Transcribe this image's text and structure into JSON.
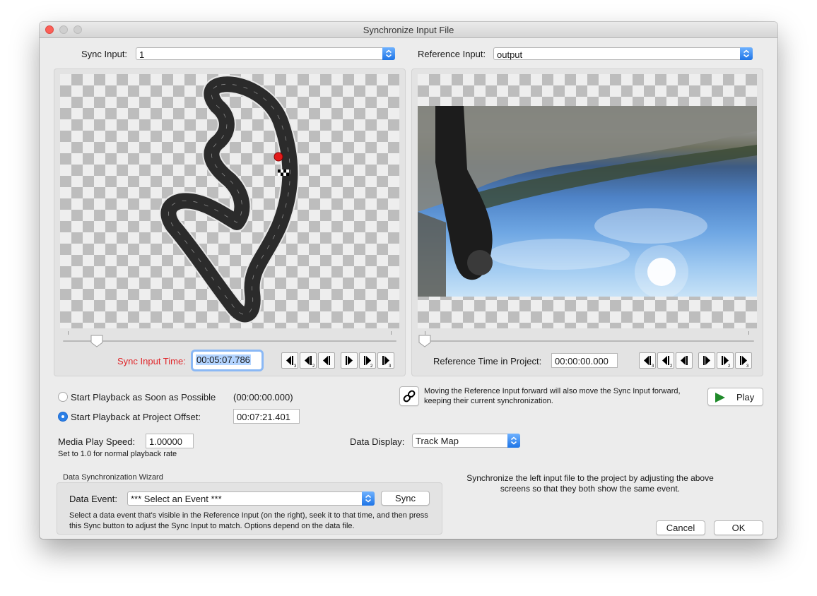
{
  "window": {
    "title": "Synchronize Input File"
  },
  "sync_input": {
    "label": "Sync Input:",
    "value": "1",
    "time_label": "Sync Input Time:",
    "time_value": "00:05:07.786",
    "slider_value": 0.09
  },
  "reference_input": {
    "label": "Reference Input:",
    "value": "output",
    "time_label": "Reference Time in Project:",
    "time_value": "00:00:00.000",
    "slider_value": 0.0
  },
  "playback": {
    "asap_label": "Start Playback as Soon as Possible",
    "asap_value": "(00:00:00.000)",
    "offset_label": "Start Playback at Project Offset:",
    "offset_value": "00:07:21.401",
    "selected": "offset"
  },
  "link": {
    "note": "Moving the Reference Input forward will also move the Sync Input forward, keeping their current synchronization."
  },
  "play_button": {
    "label": "Play"
  },
  "speed": {
    "label": "Media Play Speed:",
    "value": "1.00000",
    "hint": "Set to 1.0 for normal playback rate"
  },
  "data_display": {
    "label": "Data Display:",
    "value": "Track Map"
  },
  "wizard": {
    "title": "Data Synchronization Wizard",
    "event_label": "Data Event:",
    "event_value": "*** Select an Event ***",
    "sync_button": "Sync",
    "help": "Select a data event that's visible in the Reference Input (on the right), seek it to that time, and then press this Sync button to adjust the Sync Input to match. Options depend on the data file."
  },
  "instructions": "Synchronize the left input file to the project by adjusting the above screens so that they both show the same event.",
  "buttons": {
    "cancel": "Cancel",
    "ok": "OK"
  },
  "colors": {
    "accent": "#2b7fe6",
    "sync_time_label": "#e0262a",
    "play_icon": "#1f8a2a"
  }
}
